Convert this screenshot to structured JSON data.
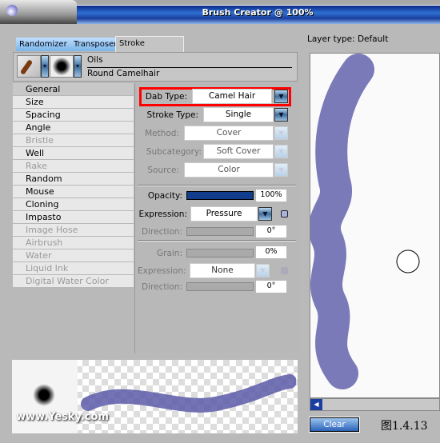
{
  "window": {
    "title": "Brush Creator @ 100%"
  },
  "tabs": [
    {
      "label": "Randomizer"
    },
    {
      "label": "Transposer"
    },
    {
      "label": "Stroke Designer",
      "active": true
    }
  ],
  "brush": {
    "category": "Oils",
    "variant": "Round Camelhair"
  },
  "sidebar": {
    "items": [
      {
        "label": "General",
        "selected": true
      },
      {
        "label": "Size"
      },
      {
        "label": "Spacing"
      },
      {
        "label": "Angle"
      },
      {
        "label": "Bristle",
        "disabled": true
      },
      {
        "label": "Well"
      },
      {
        "label": "Rake",
        "disabled": true
      },
      {
        "label": "Random"
      },
      {
        "label": "Mouse"
      },
      {
        "label": "Cloning"
      },
      {
        "label": "Impasto"
      },
      {
        "label": "Image Hose",
        "disabled": true
      },
      {
        "label": "Airbrush",
        "disabled": true
      },
      {
        "label": "Water",
        "disabled": true
      },
      {
        "label": "Liquid Ink",
        "disabled": true
      },
      {
        "label": "Digital Water Color",
        "disabled": true
      }
    ]
  },
  "general": {
    "dab_type": {
      "label": "Dab Type:",
      "value": "Camel Hair"
    },
    "stroke_type": {
      "label": "Stroke Type:",
      "value": "Single"
    },
    "method": {
      "label": "Method:",
      "value": "Cover"
    },
    "subcategory": {
      "label": "Subcategory:",
      "value": "Soft Cover"
    },
    "source": {
      "label": "Source:",
      "value": "Color"
    },
    "opacity": {
      "label": "Opacity:",
      "value": "100%",
      "level": 100
    },
    "expression1": {
      "label": "Expression:",
      "value": "Pressure"
    },
    "direction1": {
      "label": "Direction:",
      "value": "0°"
    },
    "grain": {
      "label": "Grain:",
      "value": "0%"
    },
    "expression2": {
      "label": "Expression:",
      "value": "None"
    },
    "direction2": {
      "label": "Direction:",
      "value": "0°"
    }
  },
  "preview": {
    "layer_type": "Layer type: Default",
    "clear_label": "Clear",
    "watermark": "www.Yesky.com"
  },
  "caption": "图1.4.13",
  "colors": {
    "highlight": "#ff0000",
    "stroke": "#5a5aa8",
    "accent": "#1a4aa0"
  }
}
